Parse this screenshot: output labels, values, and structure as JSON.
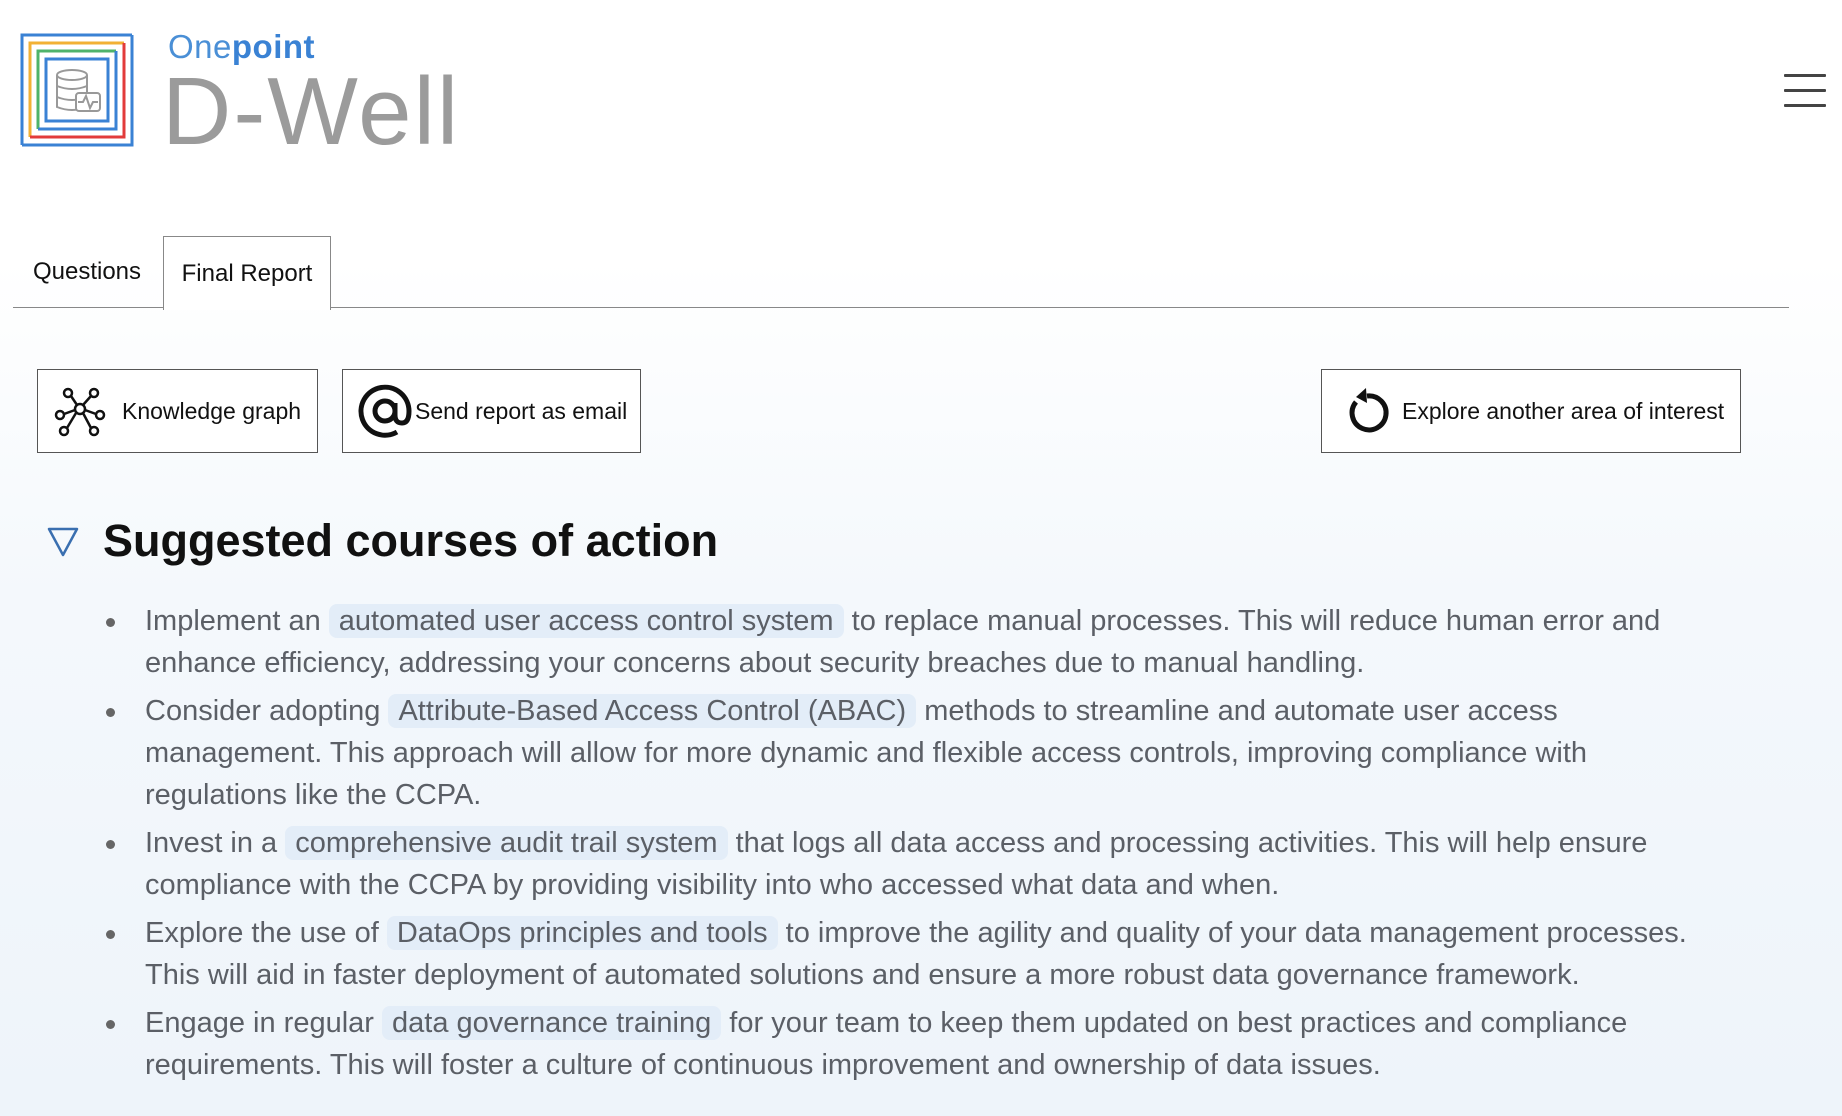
{
  "header": {
    "brand_prefix": "One",
    "brand_bold": "point",
    "app_name": "D-Well",
    "brand_color": "#3a82d4"
  },
  "tabs": [
    {
      "label": "Questions",
      "active": false
    },
    {
      "label": "Final Report",
      "active": true
    }
  ],
  "toolbar": {
    "knowledge_graph_label": "Knowledge graph",
    "send_email_label": "Send report as email",
    "explore_label": "Explore another area of interest"
  },
  "section": {
    "title": "Suggested courses of action",
    "items": [
      {
        "before": "Implement an ",
        "tag": "automated user access control system",
        "after": " to replace manual processes. This will reduce human error and enhance efficiency, addressing your concerns about security breaches due to manual handling."
      },
      {
        "before": "Consider adopting ",
        "tag": "Attribute-Based Access Control (ABAC)",
        "after": " methods to streamline and automate user access management. This approach will allow for more dynamic and flexible access controls, improving compliance with regulations like the CCPA."
      },
      {
        "before": "Invest in a ",
        "tag": "comprehensive audit trail system",
        "after": " that logs all data access and processing activities. This will help ensure compliance with the CCPA by providing visibility into who accessed what data and when."
      },
      {
        "before": "Explore the use of ",
        "tag": "DataOps principles and tools",
        "after": " to improve the agility and quality of your data management processes. This will aid in faster deployment of automated solutions and ensure a more robust data governance framework."
      },
      {
        "before": "Engage in regular ",
        "tag": "data governance training",
        "after": " for your team to keep them updated on best practices and compliance requirements. This will foster a culture of continuous improvement and ownership of data issues."
      }
    ]
  },
  "icons": {
    "logo": "database-heartbeat-logo",
    "menu": "hamburger-menu-icon",
    "graph": "network-graph-icon",
    "email": "at-sign-icon",
    "explore": "refresh-icon",
    "collapse": "triangle-down-icon"
  }
}
